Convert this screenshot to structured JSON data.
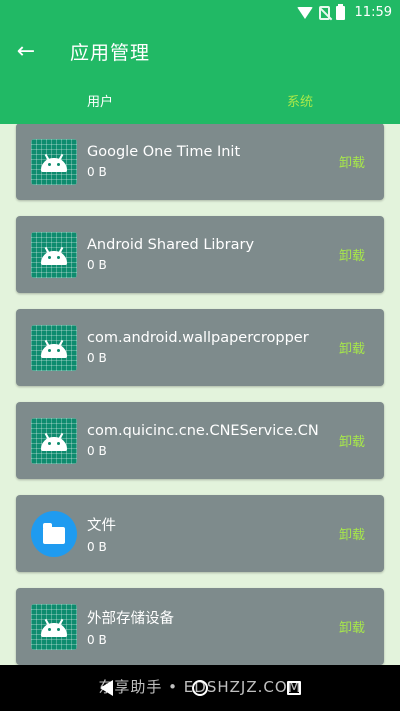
{
  "status_bar": {
    "time": "11:59"
  },
  "toolbar": {
    "title": "应用管理",
    "back_icon": "arrow-back-icon"
  },
  "tabs": [
    {
      "label": "用户",
      "active": true
    },
    {
      "label": "系统",
      "active": false
    }
  ],
  "apps": [
    {
      "name": "Google One Time Init",
      "size": "0 B",
      "action": "卸载",
      "icon": "android-icon"
    },
    {
      "name": "Android Shared Library",
      "size": "0 B",
      "action": "卸载",
      "icon": "android-icon"
    },
    {
      "name": "com.android.wallpapercropper",
      "size": "0 B",
      "action": "卸载",
      "icon": "android-icon"
    },
    {
      "name": "com.quicinc.cne.CNEService.CN..",
      "size": "0 B",
      "action": "卸载",
      "icon": "android-icon"
    },
    {
      "name": "文件",
      "size": "0 B",
      "action": "卸载",
      "icon": "folder-icon"
    },
    {
      "name": "外部存储设备",
      "size": "0 B",
      "action": "卸载",
      "icon": "android-icon"
    }
  ],
  "watermark": "东享助手 • EDSHZJZ.COM",
  "colors": {
    "header": "#21b965",
    "card": "#7e8b8c",
    "accent": "#a7e84a",
    "background": "#e3f3dc"
  }
}
